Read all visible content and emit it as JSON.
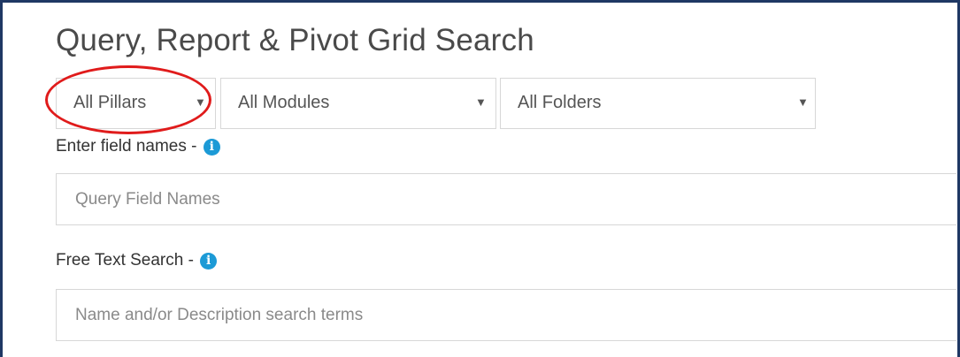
{
  "page": {
    "title": "Query, Report & Pivot Grid Search"
  },
  "filters": {
    "pillars": {
      "value": "All Pillars",
      "caret": "▼"
    },
    "modules": {
      "value": "All Modules",
      "caret": "▼"
    },
    "folders": {
      "value": "All Folders",
      "caret": "▼"
    }
  },
  "field_names": {
    "label": "Enter field names - ",
    "info_glyph": "i",
    "placeholder": "Query Field Names"
  },
  "free_text": {
    "label": "Free Text Search - ",
    "info_glyph": "i",
    "placeholder": "Name and/or Description search terms"
  },
  "annotation": {
    "highlight_color": "#e01b1b",
    "highlight_target": "pillars-select"
  },
  "colors": {
    "frame_border": "#1f3864",
    "info_icon": "#1c9ad6",
    "input_border": "#d7d7d7"
  },
  "icons": {
    "info": "info-circle-icon",
    "dropdown": "caret-down-icon"
  }
}
